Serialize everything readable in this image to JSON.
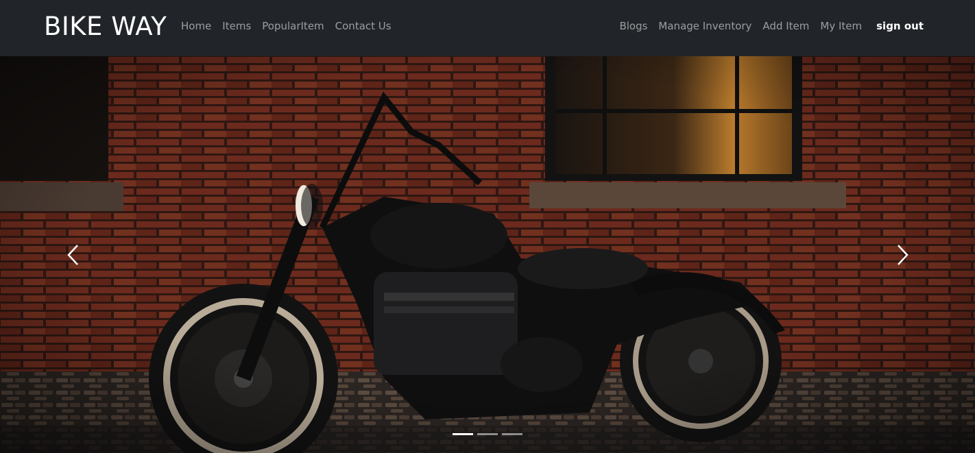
{
  "brand": "BIKE WAY",
  "nav_left": [
    {
      "label": "Home"
    },
    {
      "label": "Items"
    },
    {
      "label": "PopularItem"
    },
    {
      "label": "Contact Us"
    }
  ],
  "nav_right": [
    {
      "label": "Blogs"
    },
    {
      "label": "Manage Inventory"
    },
    {
      "label": "Add Item"
    },
    {
      "label": "My Item"
    }
  ],
  "sign_out": "sign out",
  "carousel": {
    "slide_count": 3,
    "active_index": 0,
    "prev_icon": "chevron-left-icon",
    "next_icon": "chevron-right-icon"
  },
  "colors": {
    "navbar_bg": "#212529",
    "nav_link": "rgba(255,255,255,0.55)",
    "active_link": "#ffffff",
    "brick": "#6e2a1e"
  }
}
